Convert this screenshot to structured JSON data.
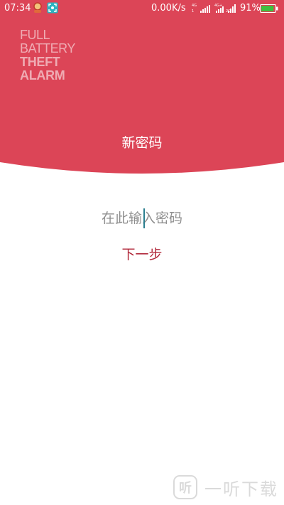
{
  "status_bar": {
    "time": "07:34",
    "net_speed": "0.00K/s",
    "battery_percent": "91%",
    "battery_level": 0.91,
    "icons": [
      "avatar-notification-icon",
      "screenshot-icon",
      "signal-4g-icon",
      "signal-4g-icon",
      "signal-icon",
      "battery-icon"
    ]
  },
  "logo": {
    "line1": "FULL",
    "line2": "BATTERY",
    "line3": "THEFT",
    "line4": "ALARM"
  },
  "header": {
    "title": "新密码"
  },
  "form": {
    "password_placeholder": "在此输入密码",
    "next_label": "下一步"
  },
  "watermark": {
    "icon_glyph": "听",
    "text": "一听下载"
  },
  "colors": {
    "header_red": "#dc4557",
    "accent_text": "#b22a3c",
    "caret": "#2b7f8f",
    "placeholder": "#8f8f8f"
  }
}
